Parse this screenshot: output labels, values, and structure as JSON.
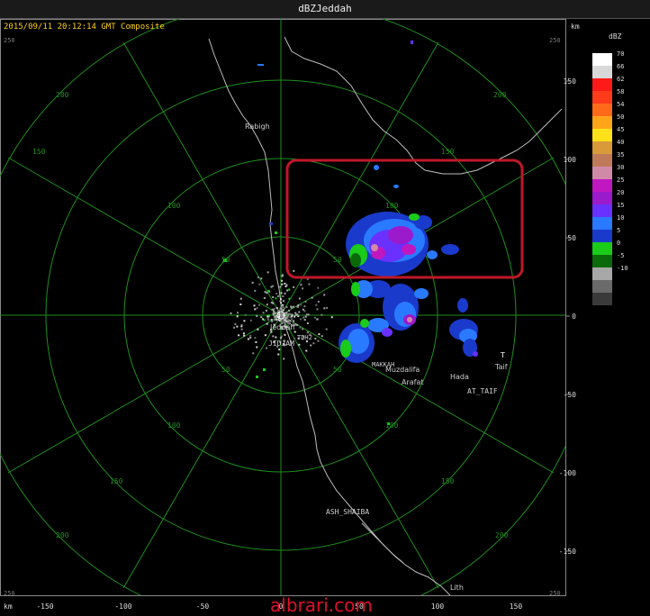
{
  "window": {
    "title": "dBZJeddah"
  },
  "header": {
    "timestamp": "2015/09/11 20:12:14 GMT Composite"
  },
  "units": {
    "km_top": "km",
    "km_bottom": "km",
    "dbz": "dBZ"
  },
  "axes": {
    "x_ticks": [
      "-150",
      "-100",
      "-50",
      "0",
      "50",
      "100",
      "150"
    ],
    "y_ticks": [
      "150",
      "100",
      "50",
      "0",
      "-50",
      "-100",
      "-150"
    ],
    "corner_ticks": [
      "250",
      "250",
      "250",
      "250"
    ]
  },
  "ring_labels": [
    "50",
    "100",
    "150",
    "200"
  ],
  "legend": {
    "values": [
      "70",
      "66",
      "62",
      "58",
      "54",
      "50",
      "45",
      "40",
      "35",
      "30",
      "25",
      "20",
      "15",
      "10",
      "5",
      "0",
      "-5",
      "-10"
    ],
    "colors": [
      "#ffffff",
      "#d8d8d8",
      "#ff1a1a",
      "#ff3b1a",
      "#ff6a1a",
      "#ffa51a",
      "#ffe11a",
      "#d89a3a",
      "#c07a5a",
      "#d08aa8",
      "#c018c0",
      "#9b1acb",
      "#6a30ff",
      "#2a7aff",
      "#1a3acb",
      "#1acb1a",
      "#0a6a0a",
      "#a8a8a8",
      "#6a6a6a",
      "#3a3a3a"
    ]
  },
  "places": [
    {
      "name": "Rabigh",
      "kind": "city"
    },
    {
      "name": "Jeddah",
      "kind": "city"
    },
    {
      "name": "JIDJAM",
      "kind": "site"
    },
    {
      "name": "TDH2",
      "kind": "site"
    },
    {
      "name": "MAKKAH",
      "kind": "city"
    },
    {
      "name": "Muzdalifa",
      "kind": "city"
    },
    {
      "name": "Arafat",
      "kind": "city"
    },
    {
      "name": "Hada",
      "kind": "city"
    },
    {
      "name": "Taif",
      "kind": "city"
    },
    {
      "name": "AT_TAIF",
      "kind": "site"
    },
    {
      "name": "ASH_SHAIBA",
      "kind": "site"
    },
    {
      "name": "Lith",
      "kind": "city"
    }
  ],
  "watermark": "albrari.com",
  "highlight_color": "#c01828"
}
